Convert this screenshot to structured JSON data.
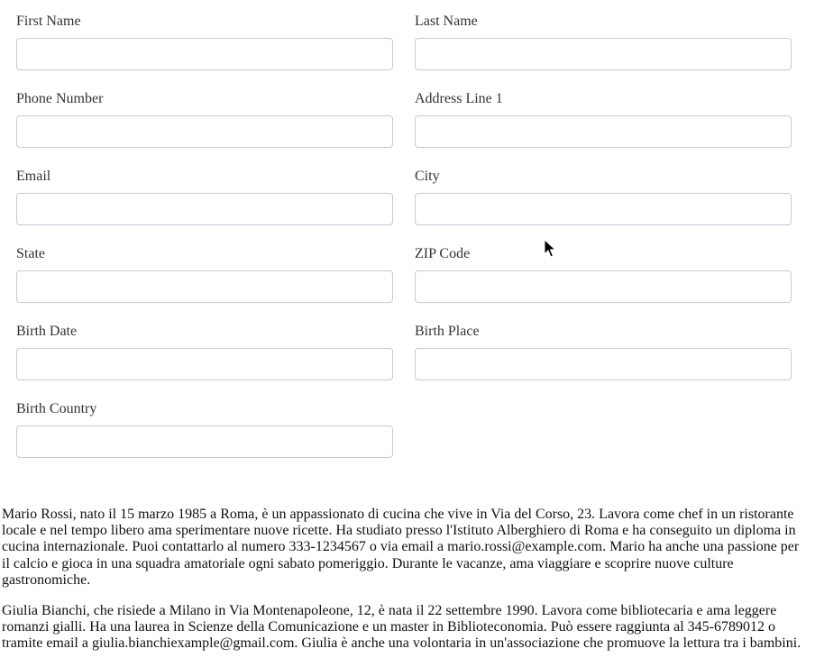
{
  "form": {
    "fields": [
      {
        "label": "First Name",
        "value": ""
      },
      {
        "label": "Last Name",
        "value": ""
      },
      {
        "label": "Phone Number",
        "value": ""
      },
      {
        "label": "Address Line 1",
        "value": ""
      },
      {
        "label": "Email",
        "value": ""
      },
      {
        "label": "City",
        "value": ""
      },
      {
        "label": "State",
        "value": ""
      },
      {
        "label": "ZIP Code",
        "value": ""
      },
      {
        "label": "Birth Date",
        "value": ""
      },
      {
        "label": "Birth Place",
        "value": ""
      },
      {
        "label": "Birth Country",
        "value": ""
      }
    ]
  },
  "bios": [
    "Mario Rossi, nato il 15 marzo 1985 a Roma, è un appassionato di cucina che vive in Via del Corso, 23. Lavora come chef in un ristorante locale e nel tempo libero ama sperimentare nuove ricette. Ha studiato presso l'Istituto Alberghiero di Roma e ha conseguito un diploma in cucina internazionale. Puoi contattarlo al numero 333-1234567 o via email a mario.rossi@example.com. Mario ha anche una passione per il calcio e gioca in una squadra amatoriale ogni sabato pomeriggio. Durante le vacanze, ama viaggiare e scoprire nuove culture gastronomiche.",
    "Giulia Bianchi, che risiede a Milano in Via Montenapoleone, 12, è nata il 22 settembre 1990. Lavora come bibliotecaria e ama leggere romanzi gialli. Ha una laurea in Scienze della Comunicazione e un master in Biblioteconomia. Può essere raggiunta al 345-6789012 o tramite email a giulia.bianchiexample@gmail.com. Giulia è anche una volontaria in un'associazione che promuove la lettura tra i bambini."
  ],
  "cursor": {
    "icon": "mouse-pointer-icon"
  }
}
